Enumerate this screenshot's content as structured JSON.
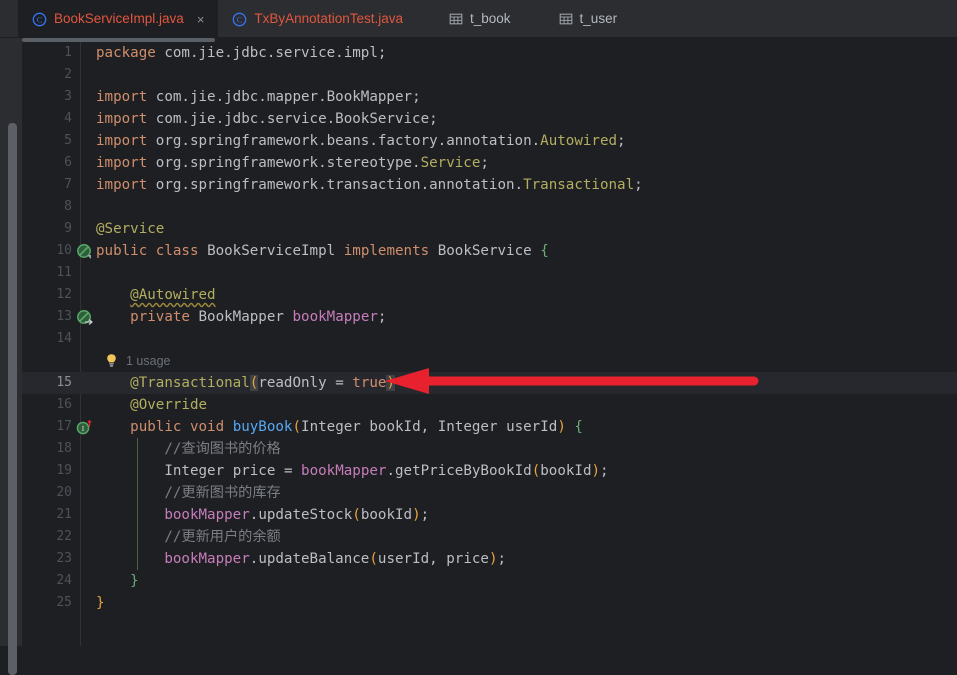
{
  "window": {
    "app": "IntelliJ IDEA Editor",
    "theme_background": "#1e1f22",
    "accent_red": "#e8212e"
  },
  "tabbar": {
    "tabs": [
      {
        "label": "BookServiceImpl.java",
        "icon": "java-class-icon",
        "active": true,
        "closeable": true,
        "close_label": "×",
        "color": "#e2563f"
      },
      {
        "label": "TxByAnnotationTest.java",
        "icon": "java-class-icon",
        "active": false,
        "closeable": false,
        "close_label": "",
        "color": "#e2563f"
      },
      {
        "label": "t_book",
        "icon": "database-table-icon",
        "active": false,
        "closeable": false,
        "close_label": "",
        "color": "#b4b8bf"
      },
      {
        "label": "t_user",
        "icon": "database-table-icon",
        "active": false,
        "closeable": false,
        "close_label": "",
        "color": "#b4b8bf"
      }
    ]
  },
  "editor": {
    "language": "Java",
    "caret_line": 15,
    "inlay_hint": {
      "text": "1 usage",
      "icon": "lightbulb-icon",
      "above_line": 15
    },
    "gutter_icons": {
      "10": "spring-bean-icon",
      "13": "spring-bean-autowired-icon",
      "17": "implementing-method-icon"
    },
    "lines": [
      {
        "n": 1,
        "text": "package com.jie.jdbc.service.impl;"
      },
      {
        "n": 2,
        "text": ""
      },
      {
        "n": 3,
        "text": "import com.jie.jdbc.mapper.BookMapper;"
      },
      {
        "n": 4,
        "text": "import com.jie.jdbc.service.BookService;"
      },
      {
        "n": 5,
        "text": "import org.springframework.beans.factory.annotation.Autowired;"
      },
      {
        "n": 6,
        "text": "import org.springframework.stereotype.Service;"
      },
      {
        "n": 7,
        "text": "import org.springframework.transaction.annotation.Transactional;"
      },
      {
        "n": 8,
        "text": ""
      },
      {
        "n": 9,
        "text": "@Service"
      },
      {
        "n": 10,
        "text": "public class BookServiceImpl implements BookService {"
      },
      {
        "n": 11,
        "text": ""
      },
      {
        "n": 12,
        "text": "    @Autowired"
      },
      {
        "n": 13,
        "text": "    private BookMapper bookMapper;"
      },
      {
        "n": 14,
        "text": ""
      },
      {
        "n": 15,
        "text": "    @Transactional(readOnly = true)"
      },
      {
        "n": 16,
        "text": "    @Override"
      },
      {
        "n": 17,
        "text": "    public void buyBook(Integer bookId, Integer userId) {"
      },
      {
        "n": 18,
        "text": "        //查询图书的价格"
      },
      {
        "n": 19,
        "text": "        Integer price = bookMapper.getPriceByBookId(bookId);"
      },
      {
        "n": 20,
        "text": "        //更新图书的库存"
      },
      {
        "n": 21,
        "text": "        bookMapper.updateStock(bookId);"
      },
      {
        "n": 22,
        "text": "        //更新用户的余额"
      },
      {
        "n": 23,
        "text": "        bookMapper.updateBalance(userId, price);"
      },
      {
        "n": 24,
        "text": "    }"
      },
      {
        "n": 25,
        "text": "}"
      }
    ]
  },
  "annotation": {
    "type": "arrow",
    "direction": "left",
    "color": "#e8212e",
    "points_at": "@Transactional(readOnly = true)"
  }
}
